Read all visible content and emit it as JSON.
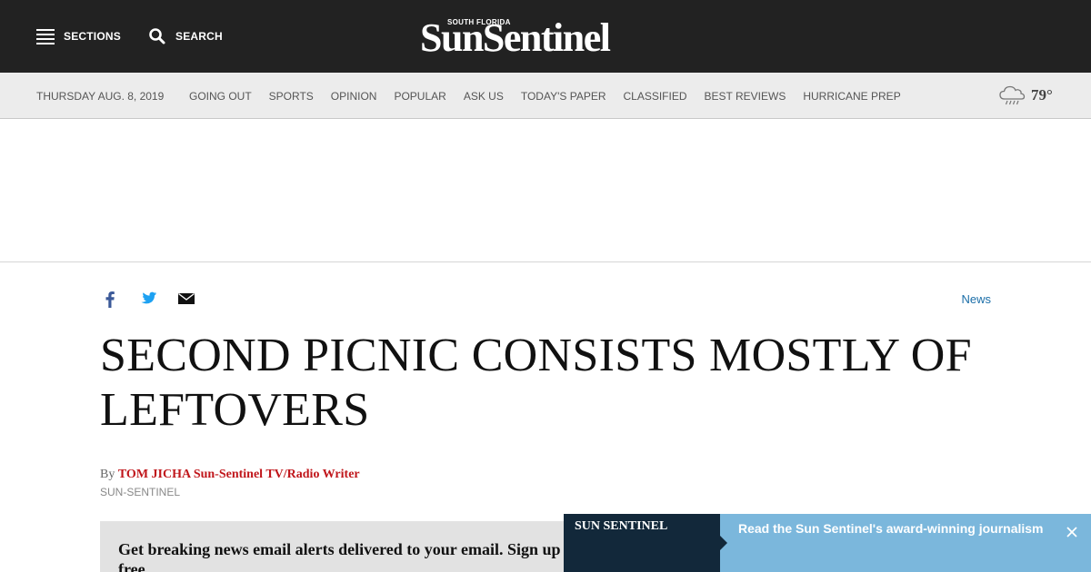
{
  "header": {
    "sections_label": "SECTIONS",
    "search_label": "SEARCH",
    "logo_top": "SOUTH FLORIDA",
    "logo_main": "SunSentinel"
  },
  "nav": {
    "date": "THURSDAY AUG. 8, 2019",
    "links": [
      "GOING OUT",
      "SPORTS",
      "OPINION",
      "POPULAR",
      "ASK US",
      "TODAY'S PAPER",
      "CLASSIFIED",
      "BEST REVIEWS",
      "HURRICANE PREP"
    ],
    "weather": {
      "icon": "cloud-rain-icon",
      "temp": "79°"
    }
  },
  "share": {
    "icons": [
      "facebook-icon",
      "twitter-icon",
      "email-icon"
    ],
    "section": "News"
  },
  "article": {
    "headline": "SECOND PICNIC CONSISTS MOSTLY OF LEFTOVERS",
    "by": "By",
    "author": "TOM JICHA Sun-Sentinel TV/Radio Writer",
    "source": "SUN-SENTINEL"
  },
  "newsletter": {
    "text": "Get breaking news email alerts delivered to your email. Sign up free."
  },
  "promo": {
    "brand": "SUN SENTINEL",
    "text": "Read the Sun Sentinel's award-winning journalism"
  },
  "colors": {
    "topbar": "#222222",
    "navbar": "#ececec",
    "author": "#c0161b",
    "link": "#1b6ea8",
    "promo_dark": "#12283a",
    "promo_light": "#7bb7dc"
  }
}
